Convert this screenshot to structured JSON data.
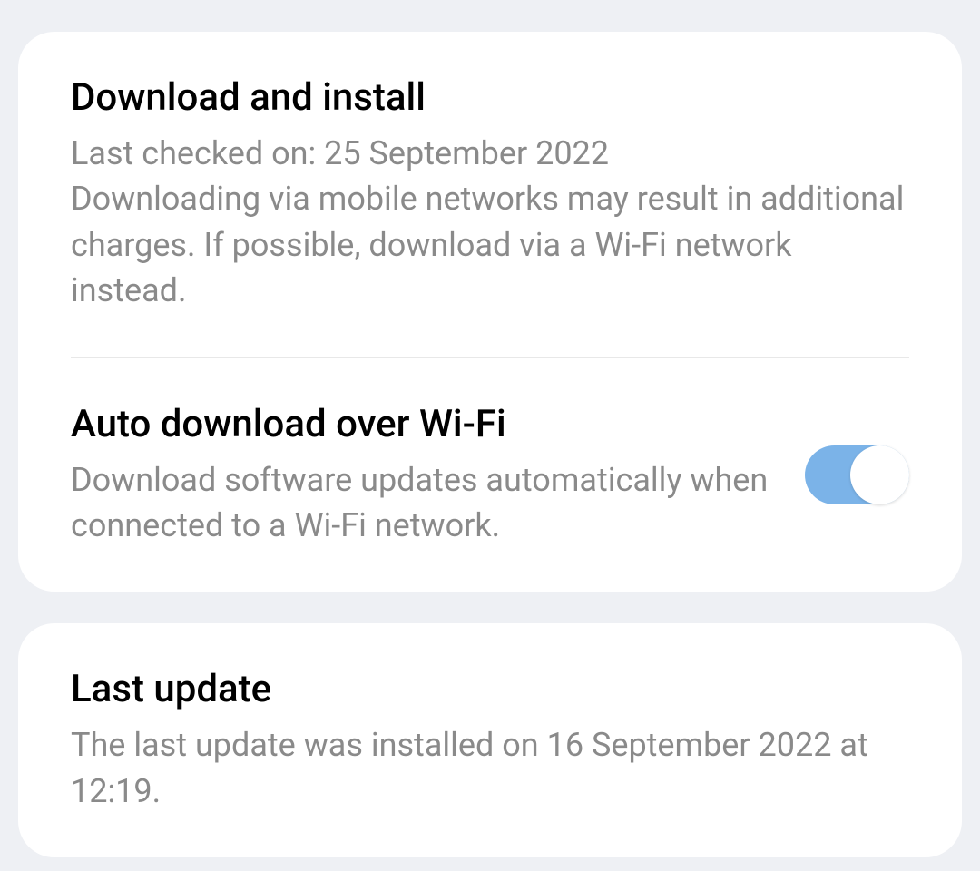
{
  "download_install": {
    "title": "Download and install",
    "last_checked": "Last checked on: 25 September 2022",
    "warning": "Downloading via mobile networks may result in additional charges. If possible, download via a Wi-Fi network instead."
  },
  "auto_download": {
    "title": "Auto download over Wi-Fi",
    "description": "Download software updates automatically when connected to a Wi-Fi network.",
    "enabled": true
  },
  "last_update": {
    "title": "Last update",
    "description": "The last update was installed on 16 September 2022 at 12:19."
  }
}
